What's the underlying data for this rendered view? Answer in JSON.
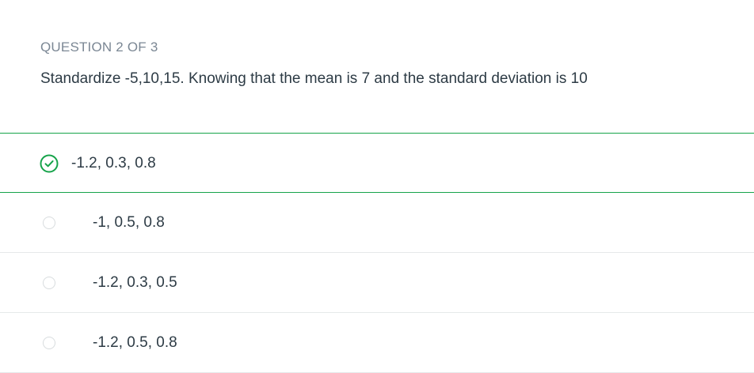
{
  "question": {
    "header": "QUESTION 2 OF 3",
    "text": "Standardize -5,10,15. Knowing that the mean is 7 and the standard deviation is 10"
  },
  "options": [
    {
      "label": "-1.2, 0.3, 0.8",
      "selected": true
    },
    {
      "label": "-1, 0.5, 0.8",
      "selected": false
    },
    {
      "label": "-1.2, 0.3, 0.5",
      "selected": false
    },
    {
      "label": "-1.2, 0.5, 0.8",
      "selected": false
    }
  ],
  "colors": {
    "accent_green": "#16a34a",
    "header_gray": "#7b8794",
    "text_dark": "#2d3b45",
    "divider": "#e6e9ea"
  },
  "icons": {
    "selected": "check-circle-icon",
    "unselected": "radio-circle-icon"
  }
}
